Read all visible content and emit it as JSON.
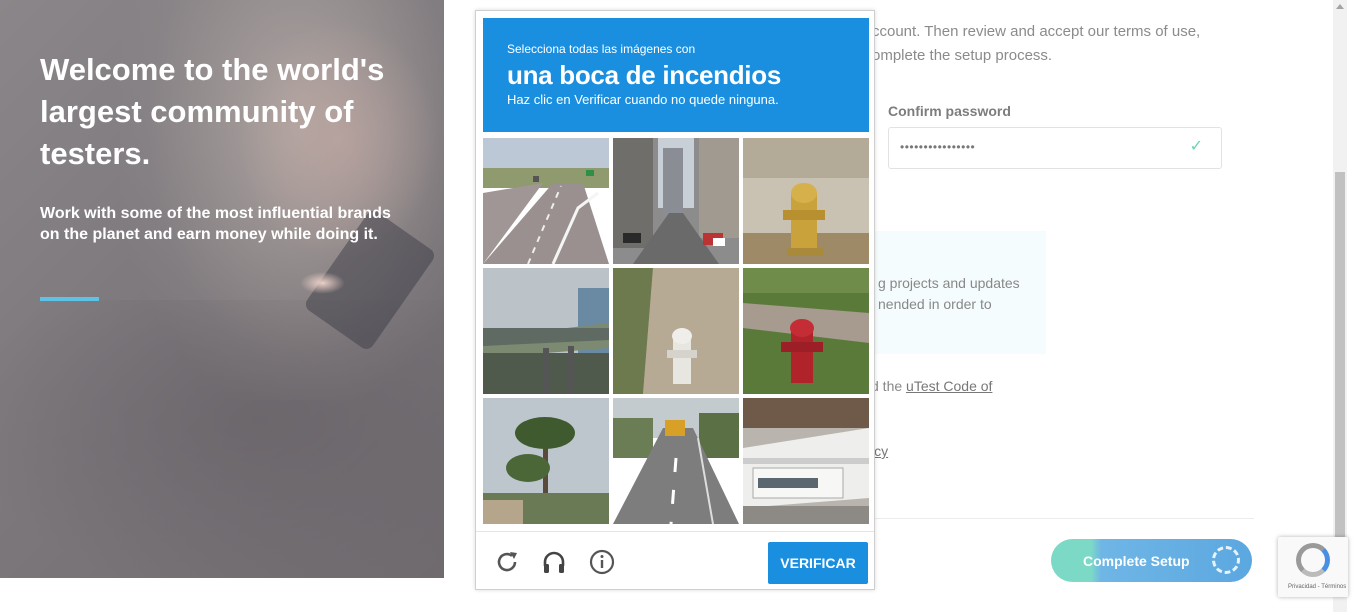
{
  "hero": {
    "title": "Welcome to the world's largest community of testers.",
    "subtitle": "Work with some of the most influential brands on the planet and earn money while doing it."
  },
  "form": {
    "intro_line1": "ccount. Then review and accept our terms of use,",
    "intro_line2": "omplete the setup process.",
    "confirm_password_label": "Confirm password",
    "confirm_password_value": "••••••••••••••••",
    "info_line1": "g projects and updates",
    "info_line2": "nended in order to",
    "agree_prefix": "d the ",
    "agree_link": "uTest Code of",
    "privacy_link": "icy",
    "complete_button": "Complete Setup"
  },
  "captcha": {
    "prompt_small": "Selecciona todas las imágenes con",
    "prompt_big": "una boca de incendios",
    "prompt_instruction": "Haz clic en Verificar cuando no quede ninguna.",
    "verify_button": "VERIFICAR",
    "tiles": [
      {
        "name": "tile-highway"
      },
      {
        "name": "tile-city-street"
      },
      {
        "name": "tile-yellow-hydrant"
      },
      {
        "name": "tile-overpass"
      },
      {
        "name": "tile-white-hydrant"
      },
      {
        "name": "tile-red-hydrant"
      },
      {
        "name": "tile-palm-trees"
      },
      {
        "name": "tile-road-bus"
      },
      {
        "name": "tile-boat"
      }
    ],
    "icons": [
      "reload-icon",
      "headphones-icon",
      "info-icon"
    ],
    "accent_color": "#1a8fe0"
  },
  "recaptcha_badge": {
    "terms": "Privacidad - Términos"
  }
}
